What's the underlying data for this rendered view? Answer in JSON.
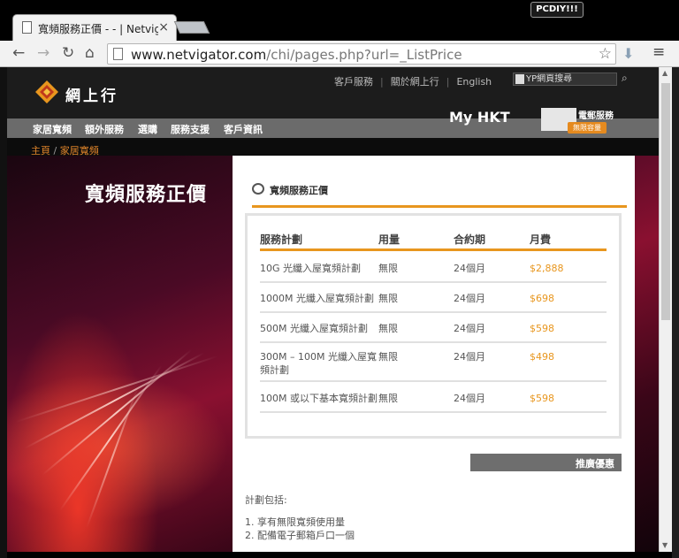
{
  "browser": {
    "tab_title": "寬頻服務正價 - - | Netvig",
    "tab_close": "×",
    "corner_badge": "PCDIY!!!",
    "url_host": "www.netvigator.com",
    "url_path": "/chi/pages.php?url=_ListPrice"
  },
  "header": {
    "logo_text": "網上行",
    "links": [
      "客戶服務",
      "關於網上行",
      "English"
    ],
    "yp_search": "YP網頁搜尋",
    "myhkt_prefix": "My ",
    "myhkt_bold": "HKT",
    "email_label": "電郵服務",
    "email_tag": "無限容量"
  },
  "nav": {
    "items": [
      "家居寬頻",
      "額外服務",
      "選購",
      "服務支援",
      "客戶資訊"
    ]
  },
  "breadcrumb": {
    "home": "主頁",
    "separator": " / ",
    "current": "家居寬頻"
  },
  "hero": {
    "title": "寬頻服務正價"
  },
  "panel": {
    "title": "寬頻服務正價",
    "columns": [
      "服務計劃",
      "用量",
      "合約期",
      "月費"
    ],
    "rows": [
      {
        "plan": "10G 光纖入屋寬頻計劃",
        "usage": "無限",
        "term": "24個月",
        "fee": "$2,888"
      },
      {
        "plan": "1000M 光纖入屋寬頻計劃",
        "usage": "無限",
        "term": "24個月",
        "fee": "$698"
      },
      {
        "plan": "500M 光纖入屋寬頻計劃",
        "usage": "無限",
        "term": "24個月",
        "fee": "$598"
      },
      {
        "plan": "300M – 100M 光纖入屋寬頻計劃",
        "usage": "無限",
        "term": "24個月",
        "fee": "$498"
      },
      {
        "plan": "100M 或以下基本寬頻計劃",
        "usage": "無限",
        "term": "24個月",
        "fee": "$598"
      }
    ],
    "promo_button": "推廣優惠",
    "plan_intro": "計劃包括:",
    "plan_items": [
      "1. 享有無限寬頻使用量",
      "2. 配備電子郵箱戶口一個"
    ]
  }
}
